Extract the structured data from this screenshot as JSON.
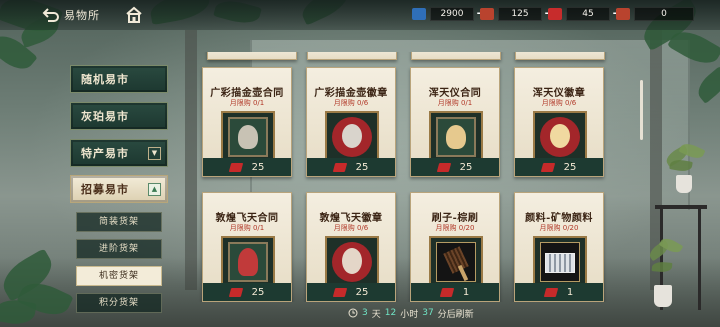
{
  "header": {
    "title": "易物所",
    "back_icon": "back-arrow-icon",
    "home_icon": "home-icon"
  },
  "currencies": [
    {
      "icon": "blue-card-icon",
      "color": "#2f6fb8",
      "value": "2900"
    },
    {
      "icon": "red-ticket-icon",
      "color": "#b9432e",
      "value": "125"
    },
    {
      "icon": "red-gem-icon",
      "color": "#c72c2c",
      "value": "45"
    },
    {
      "icon": "scroll-icon",
      "color": "#b9432e",
      "value": "0"
    }
  ],
  "nav": {
    "items": [
      {
        "label": "随机易市"
      },
      {
        "label": "灰珀易市"
      },
      {
        "label": "特产易市",
        "arrow": "▼"
      },
      {
        "label": "招募易市",
        "arrow": "▲"
      }
    ],
    "sub_items": [
      {
        "label": "简装货架"
      },
      {
        "label": "进阶货架"
      },
      {
        "label": "机密货架"
      },
      {
        "label": "积分货架"
      }
    ]
  },
  "cards": [
    {
      "title": "广彩描金壶合同",
      "limit": "月限购 0/1",
      "price": "25",
      "portrait": "#c8c2b4",
      "frame_color": "#2b4a3a"
    },
    {
      "title": "广彩描金壶徽章",
      "limit": "月限购 0/6",
      "price": "25",
      "portrait": "#d9d4cc",
      "frame_color": "#a3262a"
    },
    {
      "title": "浑天仪合同",
      "limit": "月限购 0/1",
      "price": "25",
      "portrait": "#e6c98e",
      "frame_color": "#2b4a3a"
    },
    {
      "title": "浑天仪徽章",
      "limit": "月限购 0/6",
      "price": "25",
      "portrait": "#f0d9a0",
      "frame_color": "#a3262a"
    },
    {
      "title": "敦煌飞天合同",
      "limit": "月限购 0/1",
      "price": "25",
      "portrait": "#c13a3a",
      "frame_color": "#2b4a3a"
    },
    {
      "title": "敦煌飞天徽章",
      "limit": "月限购 0/6",
      "price": "25",
      "portrait": "#b73434",
      "frame_color": "#a3262a"
    },
    {
      "title": "刷子-棕刷",
      "limit": "月限购 0/20",
      "price": "1",
      "portrait": "#5b3a22",
      "frame_color": "#141414"
    },
    {
      "title": "颜料-矿物颜料",
      "limit": "月限购 0/20",
      "price": "1",
      "portrait": "#c7ccd3",
      "frame_color": "#141414"
    }
  ],
  "refresh": {
    "d": "3",
    "d_unit": "天",
    "h": "12",
    "h_unit": "小时",
    "m": "37",
    "m_unit": "分后刷新"
  }
}
